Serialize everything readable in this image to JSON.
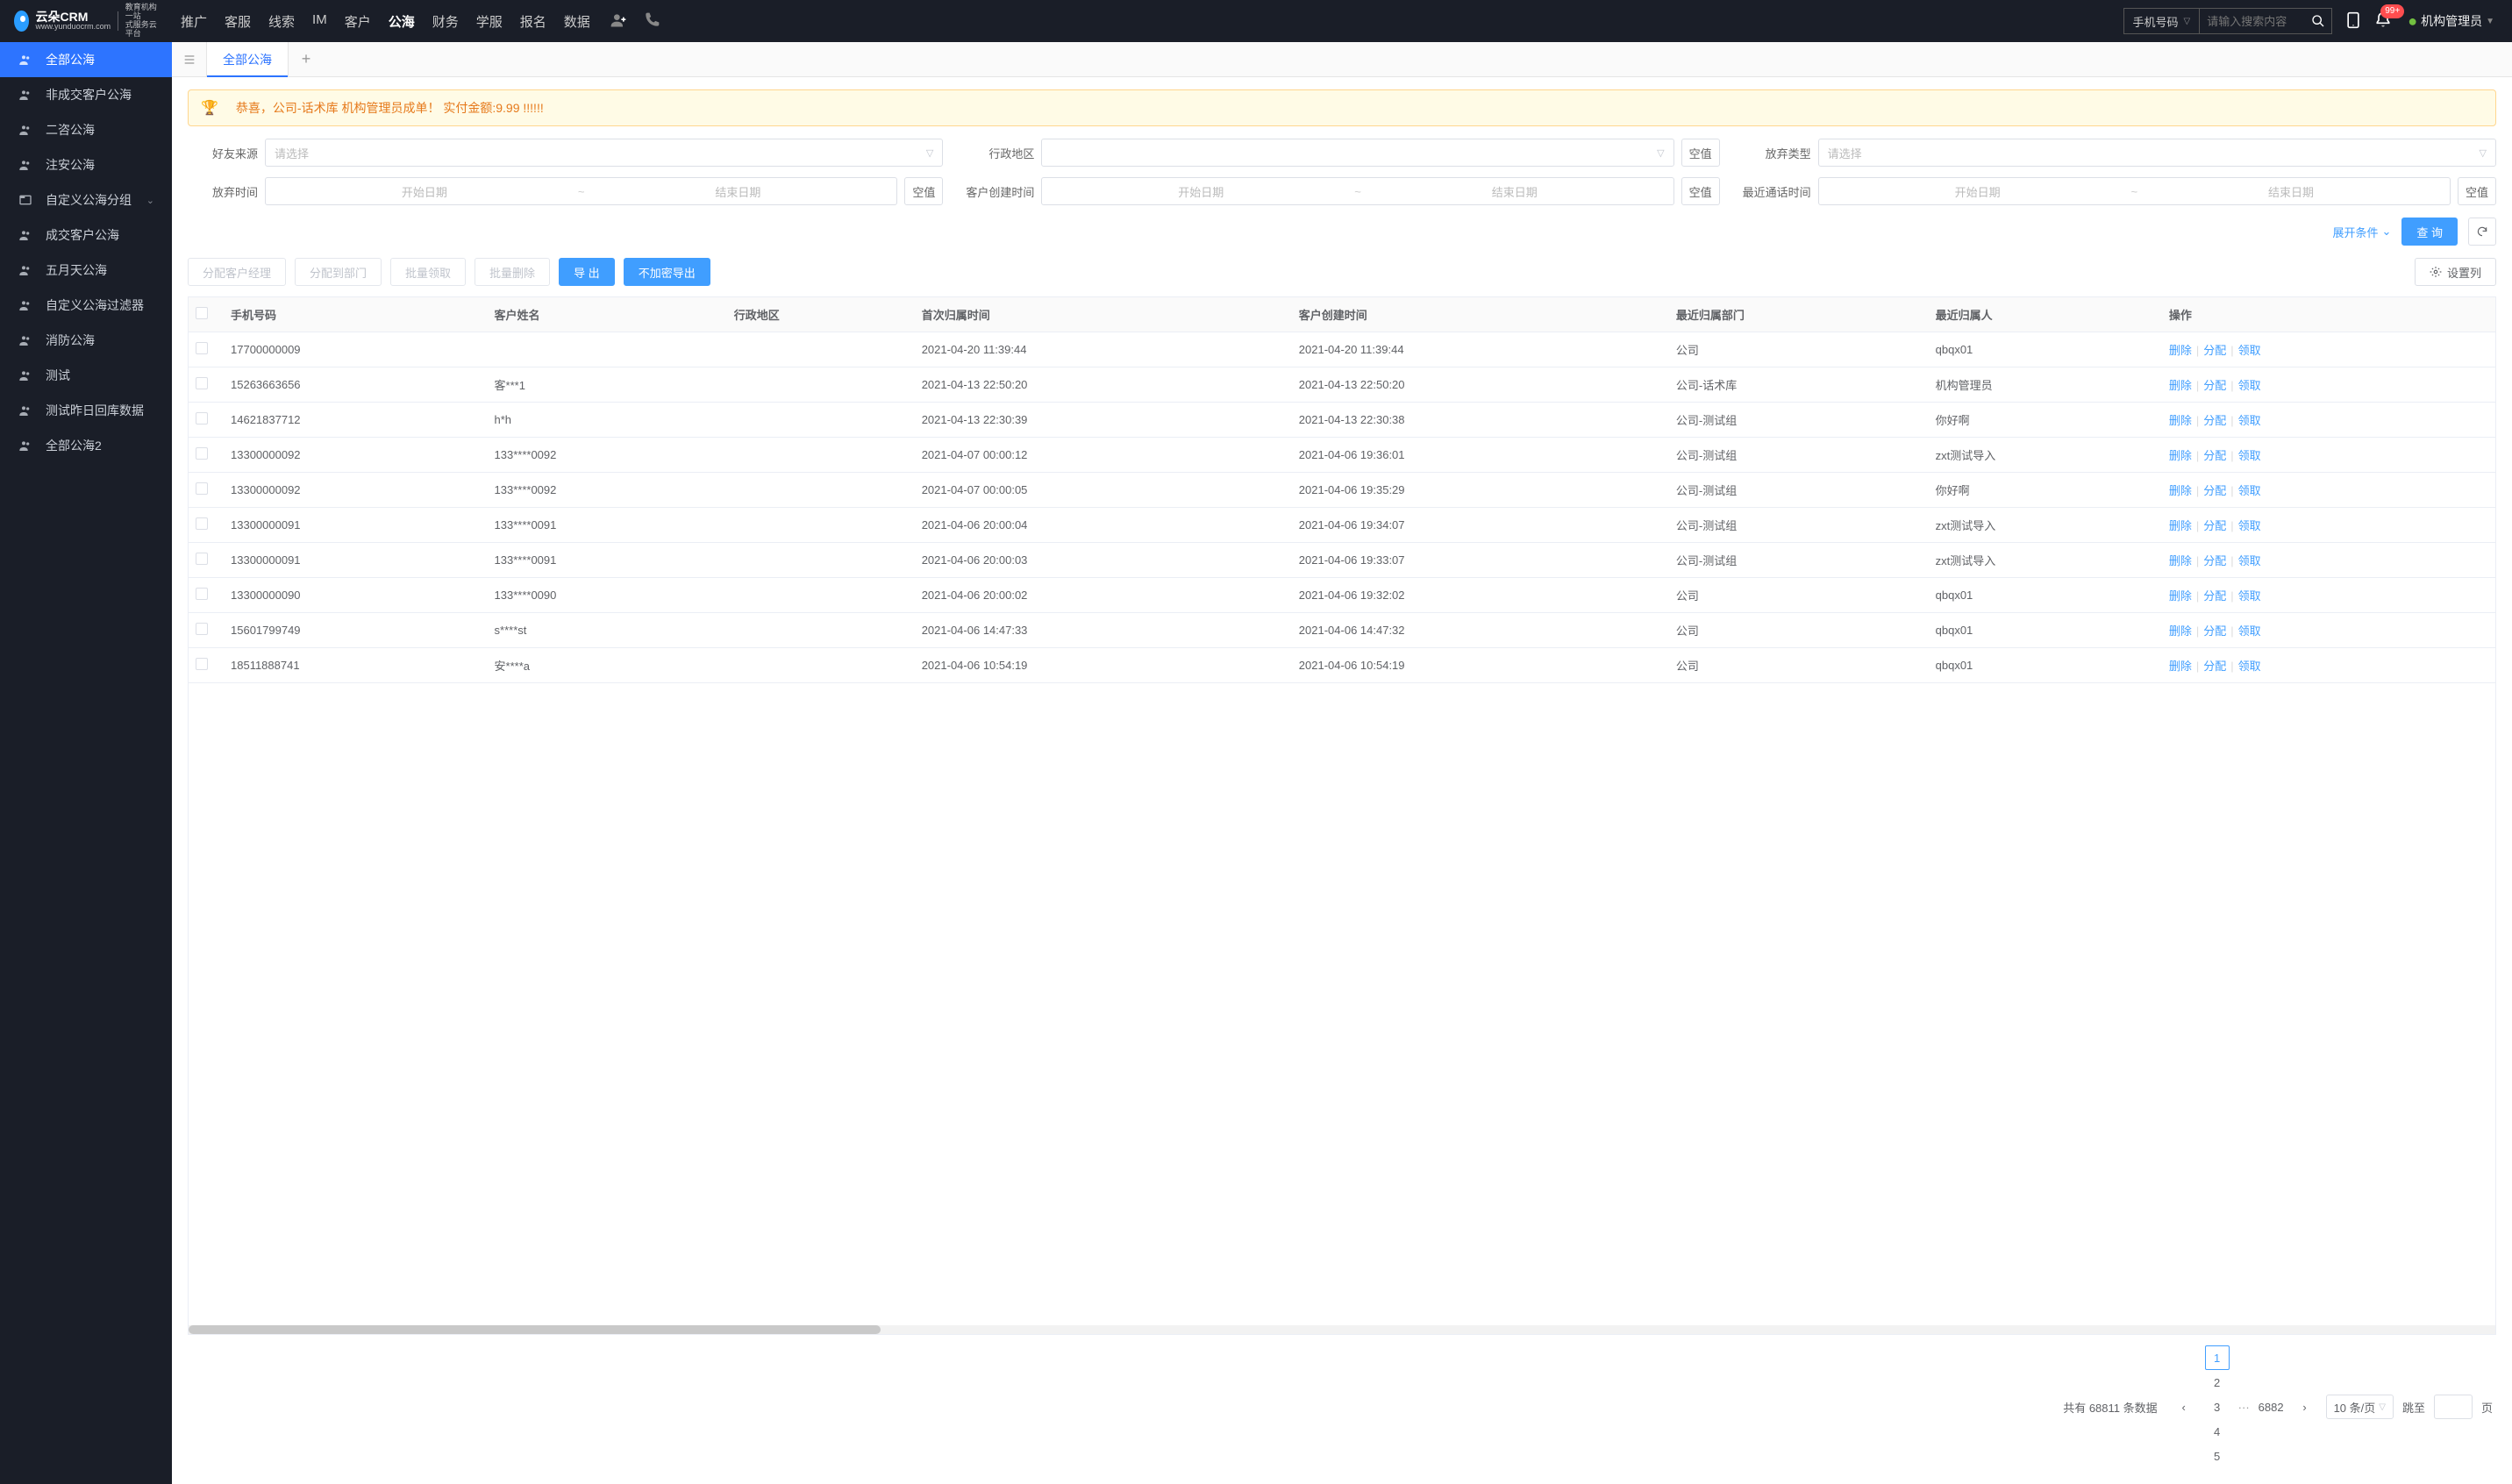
{
  "header": {
    "logo_brand": "云朵CRM",
    "logo_url": "www.yunduocrm.com",
    "logo_tag1": "教育机构一站",
    "logo_tag2": "式服务云平台",
    "nav": [
      "推广",
      "客服",
      "线索",
      "IM",
      "客户",
      "公海",
      "财务",
      "学服",
      "报名",
      "数据"
    ],
    "nav_active_index": 5,
    "search_type": "手机号码",
    "search_placeholder": "请输入搜索内容",
    "badge": "99+",
    "admin": "机构管理员"
  },
  "sidebar": {
    "items": [
      {
        "label": "全部公海",
        "icon": "users",
        "active": true
      },
      {
        "label": "非成交客户公海",
        "icon": "users"
      },
      {
        "label": "二咨公海",
        "icon": "users"
      },
      {
        "label": "注安公海",
        "icon": "users"
      },
      {
        "label": "自定义公海分组",
        "icon": "folder",
        "expandable": true
      },
      {
        "label": "成交客户公海",
        "icon": "users"
      },
      {
        "label": "五月天公海",
        "icon": "users"
      },
      {
        "label": "自定义公海过滤器",
        "icon": "users"
      },
      {
        "label": "消防公海",
        "icon": "users"
      },
      {
        "label": "测试",
        "icon": "users"
      },
      {
        "label": "测试昨日回库数据",
        "icon": "users"
      },
      {
        "label": "全部公海2",
        "icon": "users"
      }
    ]
  },
  "tabs": {
    "active": "全部公海"
  },
  "notice": "恭喜，公司-话术库   机构管理员成单！  实付金额:9.99 !!!!!!",
  "filters": {
    "placeholder_select": "请选择",
    "start_date": "开始日期",
    "end_date": "结束日期",
    "null_btn": "空值",
    "labels": {
      "friend_source": "好友来源",
      "admin_area": "行政地区",
      "abandon_type": "放弃类型",
      "abandon_time": "放弃时间",
      "create_time": "客户创建时间",
      "last_call_time": "最近通话时间"
    },
    "expand_label": "展开条件",
    "search_btn": "查 询"
  },
  "toolbar": {
    "assign_manager": "分配客户经理",
    "assign_dept": "分配到部门",
    "batch_claim": "批量领取",
    "batch_delete": "批量删除",
    "export": "导 出",
    "export_plain": "不加密导出",
    "set_columns": "设置列"
  },
  "table": {
    "headers": [
      "手机号码",
      "客户姓名",
      "行政地区",
      "首次归属时间",
      "客户创建时间",
      "最近归属部门",
      "最近归属人",
      "操作"
    ],
    "op_delete": "删除",
    "op_assign": "分配",
    "op_claim": "领取",
    "rows": [
      {
        "phone": "17700000009",
        "name": "",
        "area": "",
        "first_time": "2021-04-20 11:39:44",
        "create_time": "2021-04-20 11:39:44",
        "dept": "公司",
        "owner": "qbqx01"
      },
      {
        "phone": "15263663656",
        "name": "客***1",
        "area": "",
        "first_time": "2021-04-13 22:50:20",
        "create_time": "2021-04-13 22:50:20",
        "dept": "公司-话术库",
        "owner": "机构管理员"
      },
      {
        "phone": "14621837712",
        "name": "h*h",
        "area": "",
        "first_time": "2021-04-13 22:30:39",
        "create_time": "2021-04-13 22:30:38",
        "dept": "公司-测试组",
        "owner": "你好啊"
      },
      {
        "phone": "13300000092",
        "name": "133****0092",
        "area": "",
        "first_time": "2021-04-07 00:00:12",
        "create_time": "2021-04-06 19:36:01",
        "dept": "公司-测试组",
        "owner": "zxt测试导入"
      },
      {
        "phone": "13300000092",
        "name": "133****0092",
        "area": "",
        "first_time": "2021-04-07 00:00:05",
        "create_time": "2021-04-06 19:35:29",
        "dept": "公司-测试组",
        "owner": "你好啊"
      },
      {
        "phone": "13300000091",
        "name": "133****0091",
        "area": "",
        "first_time": "2021-04-06 20:00:04",
        "create_time": "2021-04-06 19:34:07",
        "dept": "公司-测试组",
        "owner": "zxt测试导入"
      },
      {
        "phone": "13300000091",
        "name": "133****0091",
        "area": "",
        "first_time": "2021-04-06 20:00:03",
        "create_time": "2021-04-06 19:33:07",
        "dept": "公司-测试组",
        "owner": "zxt测试导入"
      },
      {
        "phone": "13300000090",
        "name": "133****0090",
        "area": "",
        "first_time": "2021-04-06 20:00:02",
        "create_time": "2021-04-06 19:32:02",
        "dept": "公司",
        "owner": "qbqx01"
      },
      {
        "phone": "15601799749",
        "name": "s****st",
        "area": "",
        "first_time": "2021-04-06 14:47:33",
        "create_time": "2021-04-06 14:47:32",
        "dept": "公司",
        "owner": "qbqx01"
      },
      {
        "phone": "18511888741",
        "name": "安****a",
        "area": "",
        "first_time": "2021-04-06 10:54:19",
        "create_time": "2021-04-06 10:54:19",
        "dept": "公司",
        "owner": "qbqx01"
      }
    ]
  },
  "pagination": {
    "total_prefix": "共有",
    "total": "68811",
    "total_suffix": "条数据",
    "pages": [
      "1",
      "2",
      "3",
      "4",
      "5"
    ],
    "last_page": "6882",
    "page_size": "10 条/页",
    "jump_label": "跳至",
    "jump_suffix": "页"
  }
}
